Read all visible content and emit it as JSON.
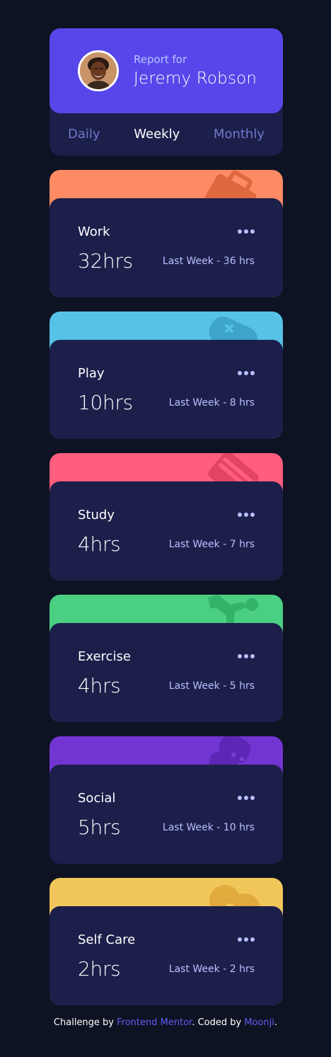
{
  "profile": {
    "report_for": "Report for",
    "name": "Jeremy Robson",
    "accent": "#5747ea"
  },
  "tabs": [
    {
      "label": "Daily",
      "active": false
    },
    {
      "label": "Weekly",
      "active": true
    },
    {
      "label": "Monthly",
      "active": false
    }
  ],
  "cards": [
    {
      "title": "Work",
      "hours": "32hrs",
      "last_week": "Last Week - 36 hrs",
      "color": "#ff8b64",
      "icon": "briefcase-icon"
    },
    {
      "title": "Play",
      "hours": "10hrs",
      "last_week": "Last Week - 8 hrs",
      "color": "#55c2e6",
      "icon": "gamepad-icon"
    },
    {
      "title": "Study",
      "hours": "4hrs",
      "last_week": "Last Week - 7 hrs",
      "color": "#ff5e7d",
      "icon": "book-icon"
    },
    {
      "title": "Exercise",
      "hours": "4hrs",
      "last_week": "Last Week - 5 hrs",
      "color": "#4bcf82",
      "icon": "running-icon"
    },
    {
      "title": "Social",
      "hours": "5hrs",
      "last_week": "Last Week - 10 hrs",
      "color": "#7335d2",
      "icon": "chat-bubble-icon"
    },
    {
      "title": "Self Care",
      "hours": "2hrs",
      "last_week": "Last Week - 2 hrs",
      "color": "#f1c75b",
      "icon": "heart-icon"
    }
  ],
  "footer": {
    "prefix": "Challenge by ",
    "link1": "Frontend Mentor",
    "middle": ". Coded by ",
    "link2": "Moonji",
    "suffix": "."
  }
}
